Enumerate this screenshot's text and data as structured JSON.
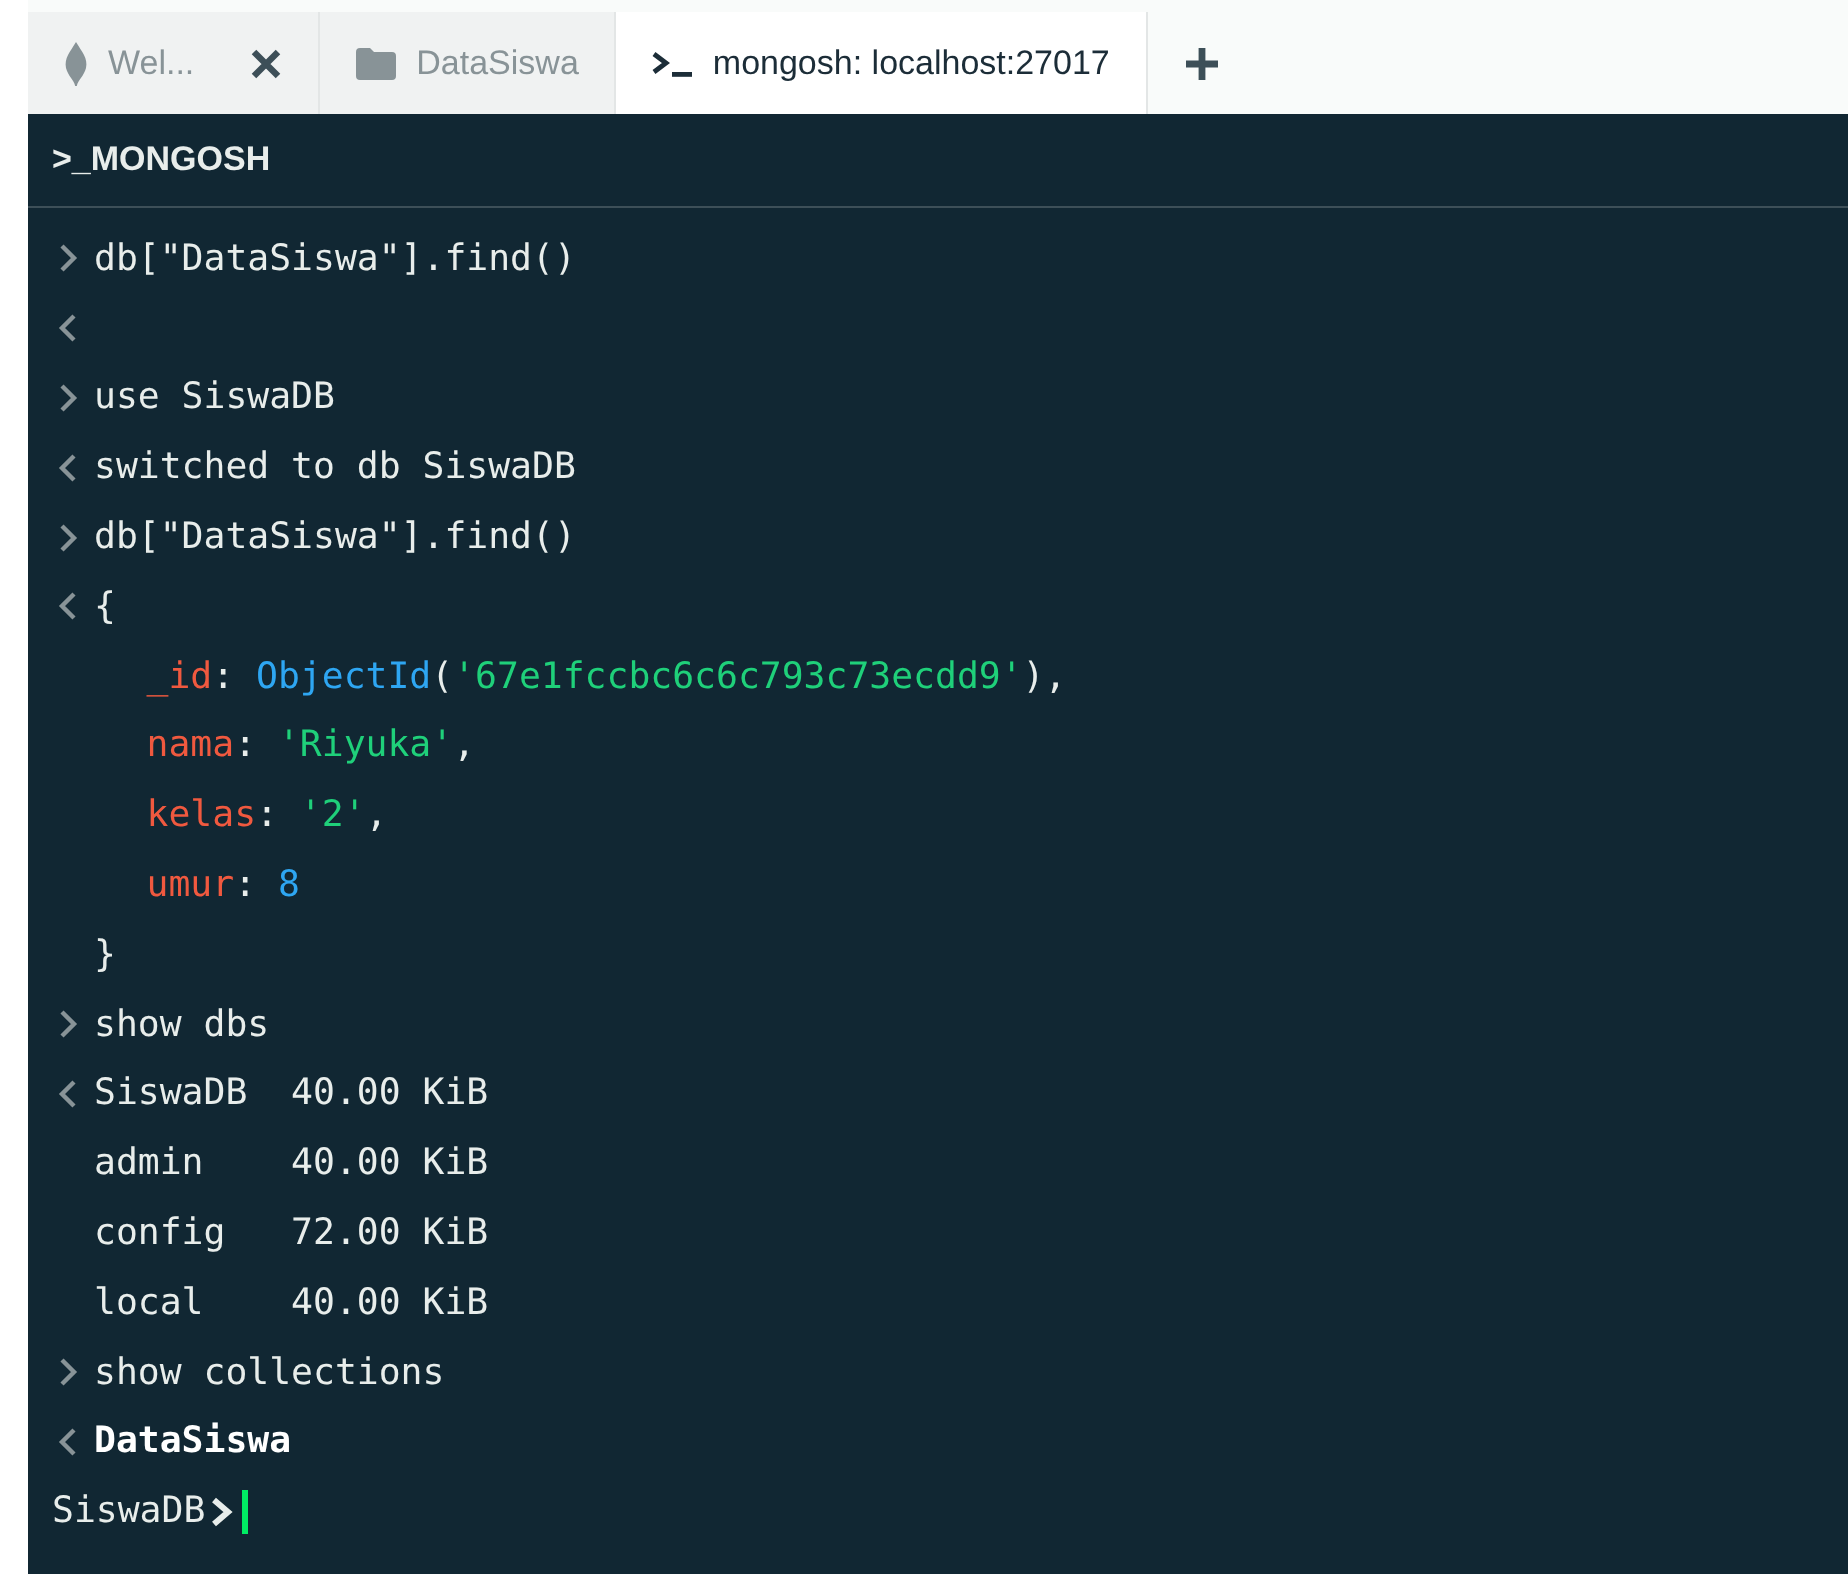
{
  "tabs": [
    {
      "kind": "leaf",
      "label": "Wel...",
      "selected": false,
      "closable": true
    },
    {
      "kind": "folder",
      "label": "DataSiswa",
      "selected": false,
      "closable": false
    },
    {
      "kind": "terminal",
      "label": "mongosh: localhost:27017",
      "selected": true,
      "closable": false
    }
  ],
  "shell": {
    "title": ">_MONGOSH",
    "lines": [
      {
        "kind": "input",
        "segments": [
          {
            "kind": "plain",
            "text": "db[\"DataSiswa\"].find()"
          }
        ]
      },
      {
        "kind": "output"
      },
      {
        "kind": "input",
        "segments": [
          {
            "kind": "plain",
            "text": "use SiswaDB"
          }
        ]
      },
      {
        "kind": "output",
        "segments": [
          {
            "kind": "plain",
            "text": "switched to db SiswaDB"
          }
        ]
      },
      {
        "kind": "input",
        "segments": [
          {
            "kind": "plain",
            "text": "db[\"DataSiswa\"].find()"
          }
        ]
      },
      {
        "kind": "output",
        "segments": [
          {
            "kind": "plain",
            "text": "{"
          }
        ]
      },
      {
        "kind": "field",
        "segments": [
          {
            "kind": "key",
            "text": "_id"
          },
          {
            "kind": "plain",
            "text": ": "
          },
          {
            "kind": "func",
            "text": "ObjectId"
          },
          {
            "kind": "plain",
            "text": "("
          },
          {
            "kind": "string",
            "text": "'67e1fccbc6c6c793c73ecdd9'"
          },
          {
            "kind": "plain",
            "text": "),"
          }
        ]
      },
      {
        "kind": "field",
        "segments": [
          {
            "kind": "key",
            "text": "nama"
          },
          {
            "kind": "plain",
            "text": ": "
          },
          {
            "kind": "string",
            "text": "'Riyuka'"
          },
          {
            "kind": "plain",
            "text": ","
          }
        ]
      },
      {
        "kind": "field",
        "segments": [
          {
            "kind": "key",
            "text": "kelas"
          },
          {
            "kind": "plain",
            "text": ": "
          },
          {
            "kind": "string",
            "text": "'2'"
          },
          {
            "kind": "plain",
            "text": ","
          }
        ]
      },
      {
        "kind": "field",
        "segments": [
          {
            "kind": "key",
            "text": "umur"
          },
          {
            "kind": "plain",
            "text": ": "
          },
          {
            "kind": "number",
            "text": "8"
          }
        ]
      },
      {
        "kind": "continuation",
        "segments": [
          {
            "kind": "plain",
            "text": "}"
          }
        ]
      },
      {
        "kind": "input",
        "segments": [
          {
            "kind": "plain",
            "text": "show dbs"
          }
        ]
      },
      {
        "kind": "output",
        "segments": [
          {
            "kind": "plain",
            "text": "SiswaDB  40.00 KiB"
          }
        ]
      },
      {
        "kind": "continuation",
        "segments": [
          {
            "kind": "plain",
            "text": "admin    40.00 KiB"
          }
        ]
      },
      {
        "kind": "continuation",
        "segments": [
          {
            "kind": "plain",
            "text": "config   72.00 KiB"
          }
        ]
      },
      {
        "kind": "continuation",
        "segments": [
          {
            "kind": "plain",
            "text": "local    40.00 KiB"
          }
        ]
      },
      {
        "kind": "input",
        "segments": [
          {
            "kind": "plain",
            "text": "show collections"
          }
        ]
      },
      {
        "kind": "output",
        "segments": [
          {
            "kind": "bold",
            "text": "DataSiswa"
          }
        ]
      }
    ],
    "prompt": "SiswaDB"
  }
}
